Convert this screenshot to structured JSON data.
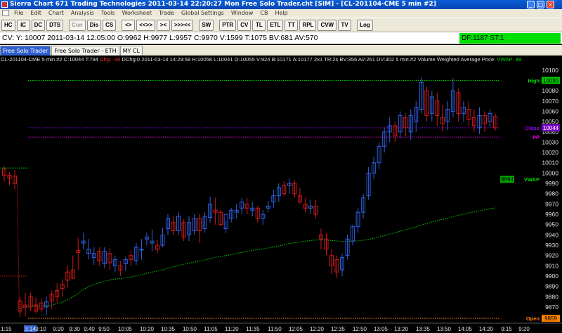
{
  "window": {
    "title": "Sierra Chart 671 Trading Technologies 2011-03-14  22:20:27  Mon    Free Solo Trader.cht [SIM]  - [CL-201104-CME  5 min  #2]",
    "minimize": "_",
    "restore": "□",
    "close": "×"
  },
  "menu": [
    "File",
    "Edit",
    "Chart",
    "Analysis",
    "Tools",
    "Worksheet",
    "Trade",
    "Global Settings",
    "Window",
    "CB",
    "Help"
  ],
  "toolbar": {
    "buttons": [
      {
        "label": "HC",
        "enabled": true
      },
      {
        "label": "IC",
        "enabled": true
      },
      {
        "label": "DC",
        "enabled": true
      },
      {
        "label": "DTS",
        "enabled": true
      },
      {
        "label": "Con",
        "enabled": false
      },
      {
        "label": "Dis",
        "enabled": true
      },
      {
        "label": "CS",
        "enabled": true
      },
      {
        "label": "<>",
        "enabled": true
      },
      {
        "label": "<<>>",
        "enabled": true
      },
      {
        "label": "><",
        "enabled": true
      },
      {
        "label": ">>><<",
        "enabled": true
      },
      {
        "label": "SW",
        "enabled": true
      },
      {
        "label": "PTR",
        "enabled": true
      },
      {
        "label": "CV",
        "enabled": true
      },
      {
        "label": "TL",
        "enabled": true
      },
      {
        "label": "ETL",
        "enabled": true
      },
      {
        "label": "TT",
        "enabled": true
      },
      {
        "label": "RPL",
        "enabled": true
      },
      {
        "label": "CVW",
        "enabled": true
      },
      {
        "label": "TV",
        "enabled": true
      },
      {
        "label": "Log",
        "enabled": true
      }
    ]
  },
  "databar": {
    "text": "CV: Y: 10007  2011-03-14  12:05:00  O:9962  H:9977  L:9957  C:9970  V:1599  T:1075  BV:681  AV:570",
    "status": "DF:1187  ST:1"
  },
  "tabs": [
    {
      "label": "Free Solo Trader",
      "active": true
    },
    {
      "label": "Free Solo Trader - ETH",
      "active": false
    },
    {
      "label": "MY CL",
      "active": false
    }
  ],
  "chart_header": {
    "part1": "CL-201104-CME  5 min   #2 C:10044 T:784 ",
    "chg": "Chg: -16",
    "part2": " DChg:0 2011-03-14 14:29:58 H:10058 L:10041 O:10055 V:924 B:10171 A:10177 2x1 TR:2s BV:356 AV:261 DV:302 5 min  #2  Volume Weighted Average Price: ",
    "vwap": "VWAP: 99"
  },
  "colors": {
    "up_candle": "#3060e0",
    "down_candle": "#d01818",
    "vwap_line": "#00cc00",
    "high_line": "#00cc00",
    "close_line": "#8000c0",
    "pp_line": "#d000d0",
    "open_line": "#ff8000",
    "label_vwap": "#00dd00",
    "label_close": "#a000ff",
    "label_pp": "#ff00ff",
    "label_open": "#ff8000"
  },
  "chart_data": {
    "type": "candlestick",
    "price_axis": {
      "min": 9860,
      "max": 10100,
      "step": 10
    },
    "time_labels": [
      "3:14",
      "9:10",
      "9:20",
      "9:30",
      "9:40",
      "9:50",
      "10:05",
      "10:20",
      "10:35",
      "10:50",
      "11:05",
      "11:20",
      "11:35",
      "11:50",
      "12:05",
      "12:20",
      "12:35",
      "12:50",
      "13:05",
      "13:20",
      "13:35",
      "13:50",
      "14:05",
      "14:20",
      "9:15",
      "9:20"
    ],
    "time_label_first": "1:15",
    "levels": {
      "high": {
        "label": "High",
        "value": 10090
      },
      "close": {
        "label": "Close",
        "value": 10044
      },
      "pp": {
        "label": "PP",
        "value": 10035
      },
      "vwap": {
        "label": "VWAP",
        "value": 9994
      },
      "open": {
        "label": "Open",
        "value": 9859
      }
    },
    "candles": [
      [
        10004,
        10007,
        9998,
        9992
      ],
      [
        9998,
        10001,
        9995,
        9988
      ],
      [
        9997,
        10003,
        9990,
        9984
      ],
      [
        9876,
        9880,
        9866,
        9860
      ],
      [
        9872,
        9884,
        9870,
        9861
      ],
      [
        9880,
        9884,
        9870,
        9866
      ],
      [
        9872,
        9879,
        9866,
        9864
      ],
      [
        9874,
        9878,
        9868,
        9865
      ],
      [
        9870,
        9880,
        9875,
        9862
      ],
      [
        9882,
        9886,
        9876,
        9868
      ],
      [
        9886,
        9893,
        9880,
        9874
      ],
      [
        9892,
        9897,
        9888,
        9880
      ],
      [
        9904,
        9910,
        9896,
        9889
      ],
      [
        9906,
        9920,
        9898,
        9897
      ],
      [
        9925,
        9937,
        9923,
        9906
      ],
      [
        9932,
        9942,
        9934,
        9926
      ],
      [
        9922,
        9936,
        9926,
        9916
      ],
      [
        9918,
        9928,
        9922,
        9911
      ],
      [
        9924,
        9928,
        9915,
        9910
      ],
      [
        9912,
        9928,
        9924,
        9908
      ],
      [
        9922,
        9927,
        9913,
        9906
      ],
      [
        9910,
        9920,
        9916,
        9904
      ],
      [
        9910,
        9915,
        9906,
        9900
      ],
      [
        9912,
        9919,
        9916,
        9905
      ],
      [
        9920,
        9925,
        9916,
        9910
      ],
      [
        9915,
        9932,
        9928,
        9911
      ],
      [
        9926,
        9936,
        9926,
        9916
      ],
      [
        9936,
        9942,
        9938,
        9930
      ],
      [
        9932,
        9945,
        9934,
        9924
      ],
      [
        9930,
        9935,
        9926,
        9922
      ],
      [
        9930,
        9947,
        9940,
        9928
      ],
      [
        9946,
        9960,
        9956,
        9940
      ],
      [
        9952,
        9958,
        9944,
        9940
      ],
      [
        9944,
        9962,
        9958,
        9940
      ],
      [
        9952,
        9955,
        9938,
        9934
      ],
      [
        9940,
        9958,
        9952,
        9934
      ],
      [
        9944,
        9960,
        9956,
        9940
      ],
      [
        9956,
        9960,
        9944,
        9932
      ],
      [
        9946,
        9962,
        9958,
        9942
      ],
      [
        9957,
        9977,
        9970,
        9952
      ],
      [
        9964,
        9976,
        9962,
        9950
      ],
      [
        9962,
        9964,
        9950,
        9948
      ],
      [
        9946,
        9954,
        9960,
        9942
      ],
      [
        9956,
        9966,
        9964,
        9952
      ],
      [
        9962,
        9970,
        9964,
        9956
      ],
      [
        9966,
        9976,
        9972,
        9960
      ],
      [
        9970,
        9976,
        9966,
        9960
      ],
      [
        9964,
        9972,
        9966,
        9958
      ],
      [
        9966,
        9968,
        9956,
        9952
      ],
      [
        9956,
        9964,
        9960,
        9950
      ],
      [
        9966,
        9973,
        9968,
        9962
      ],
      [
        9972,
        9984,
        9978,
        9966
      ],
      [
        9978,
        9990,
        9986,
        9972
      ],
      [
        9988,
        9992,
        9980,
        9978
      ],
      [
        9988,
        9995,
        9990,
        9980
      ],
      [
        9990,
        9993,
        9980,
        9976
      ],
      [
        9978,
        9986,
        9972,
        9970
      ],
      [
        9970,
        9976,
        9966,
        9962
      ],
      [
        9966,
        9974,
        9968,
        9960
      ],
      [
        9968,
        9974,
        9960,
        9956
      ],
      [
        9940,
        9946,
        9936,
        9926
      ],
      [
        9936,
        9942,
        9926,
        9920
      ],
      [
        9920,
        9926,
        9910,
        9902
      ],
      [
        9916,
        9920,
        9904,
        9898
      ],
      [
        9906,
        9922,
        9918,
        9900
      ],
      [
        9920,
        9940,
        9936,
        9916
      ],
      [
        9934,
        9950,
        9948,
        9930
      ],
      [
        9948,
        9966,
        9962,
        9942
      ],
      [
        9962,
        9980,
        9976,
        9956
      ],
      [
        9978,
        10006,
        10000,
        9974
      ],
      [
        10000,
        10016,
        10010,
        9994
      ],
      [
        10010,
        10030,
        10026,
        10004
      ],
      [
        10026,
        10044,
        10040,
        10020
      ],
      [
        10040,
        10054,
        10046,
        10030
      ],
      [
        10046,
        10050,
        10036,
        10030
      ],
      [
        10040,
        10060,
        10056,
        10034
      ],
      [
        10054,
        10058,
        10044,
        10036
      ],
      [
        10040,
        10062,
        10056,
        10032
      ],
      [
        10050,
        10070,
        10064,
        10040
      ],
      [
        10062,
        10093,
        10088,
        10058
      ],
      [
        10080,
        10084,
        10056,
        10050
      ],
      [
        10058,
        10080,
        10074,
        10050
      ],
      [
        10070,
        10078,
        10056,
        10046
      ],
      [
        10054,
        10066,
        10048,
        10040
      ],
      [
        10050,
        10070,
        10062,
        10042
      ],
      [
        10060,
        10092,
        10080,
        10054
      ],
      [
        10078,
        10082,
        10058,
        10050
      ],
      [
        10058,
        10070,
        10064,
        10050
      ],
      [
        10062,
        10070,
        10052,
        10046
      ],
      [
        10054,
        10062,
        10046,
        10040
      ],
      [
        10044,
        10064,
        10056,
        10038
      ],
      [
        10056,
        10060,
        10048,
        10040
      ],
      [
        10050,
        10062,
        10058,
        10044
      ],
      [
        10055,
        10058,
        10044,
        10041
      ]
    ]
  }
}
